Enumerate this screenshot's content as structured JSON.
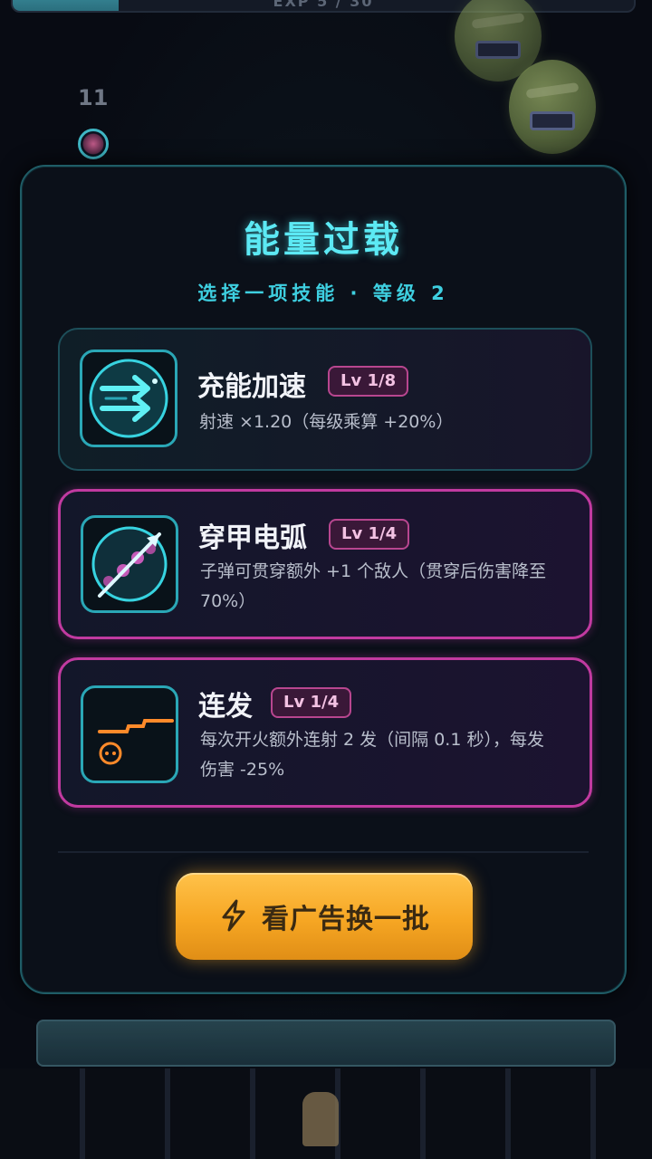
{
  "hud": {
    "exp_text": "EXP 5 / 30",
    "exp_progress": 0.17,
    "ball_count": "11"
  },
  "dialog": {
    "title": "能量过载",
    "subtitle": "选择一项技能 · 等级 2",
    "skills": [
      {
        "name": "充能加速",
        "level": "Lv 1/8",
        "description": "射速 ×1.20（每级乘算 +20%）",
        "icon": "speed-arrows-icon"
      },
      {
        "name": "穿甲电弧",
        "level": "Lv 1/4",
        "description": "子弹可贯穿额外 +1 个敌人（贯穿后伤害降至 70%）",
        "icon": "piercing-arc-icon"
      },
      {
        "name": "连发",
        "level": "Lv 1/4",
        "description": "每次开火额外连射 2 发（间隔 0.1 秒），每发伤害 -25%",
        "icon": "burst-fire-icon"
      }
    ],
    "refresh_button": {
      "label": "看广告换一批",
      "icon": "lightning-icon"
    }
  },
  "colors": {
    "accent_cyan": "#5ce9f4",
    "accent_magenta": "#c13aa0",
    "button_orange": "#f6a623"
  }
}
